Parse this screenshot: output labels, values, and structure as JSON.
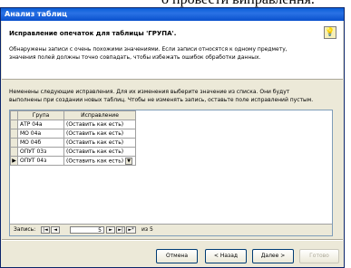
{
  "top_text": "о провести виправлення.",
  "window": {
    "title": "Анализ таблиц"
  },
  "header": {
    "title": "Исправление опечаток для таблицы 'ГРУПА'.",
    "description": "Обнаружены записи с очень похожими значениями. Если записи относятся к одному предмету, значения полей должны точно совпадать, чтобы избежать ошибок обработки данных."
  },
  "note": "Неменены следующие исправления. Для их изменения выберите значение из списка. Они будут выполнены при создании новых таблиц. Чтобы не изменять запись, оставьте поле исправлений пустым.",
  "grid": {
    "columns": [
      "Група",
      "Исправление"
    ],
    "rows": [
      {
        "group": "АТР 04а",
        "fix": "(Оставить как есть)"
      },
      {
        "group": "МО 04а",
        "fix": "(Оставить как есть)"
      },
      {
        "group": "МО 04б",
        "fix": "(Оставить как есть)"
      },
      {
        "group": "ОПУТ 03з",
        "fix": "(Оставить как есть)"
      },
      {
        "group": "ОПУТ 04з",
        "fix": "(Оставить как есть)"
      }
    ]
  },
  "navigator": {
    "label": "Запись:",
    "current": "5",
    "of_label": "из 5",
    "first": "|◄",
    "prev": "◄",
    "next": "►",
    "last": "►|",
    "new": "►*"
  },
  "buttons": {
    "cancel": "Отмена",
    "back": "< Назад",
    "next": "Далее >",
    "finish": "Готово"
  }
}
